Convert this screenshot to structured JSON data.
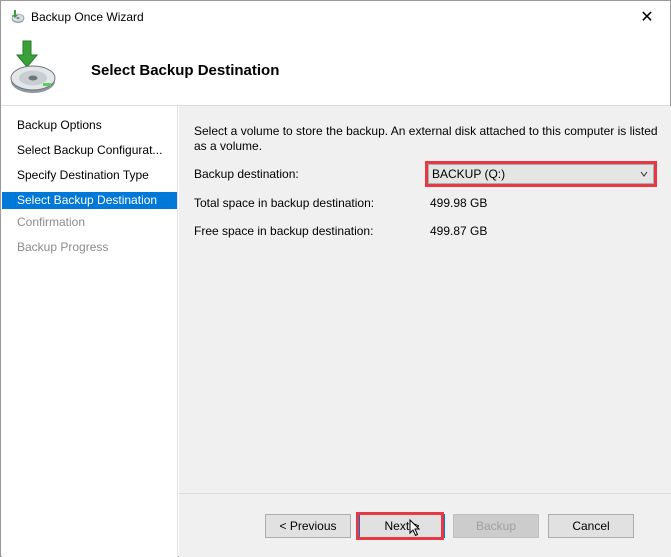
{
  "window": {
    "title": "Backup Once Wizard",
    "close_glyph": "✕"
  },
  "header": {
    "title": "Select Backup Destination",
    "icon": "backup-disk-icon"
  },
  "sidebar": {
    "items": [
      {
        "label": "Backup Options",
        "state": "normal"
      },
      {
        "label": "Select Backup Configurat...",
        "state": "normal"
      },
      {
        "label": "Specify Destination Type",
        "state": "normal"
      },
      {
        "label": "Select Backup Destination",
        "state": "active"
      },
      {
        "label": "Confirmation",
        "state": "disabled"
      },
      {
        "label": "Backup Progress",
        "state": "disabled"
      }
    ]
  },
  "content": {
    "intro": "Select a volume to store the backup. An external disk attached to this computer is listed as a volume.",
    "destination_label": "Backup destination:",
    "destination_value": "BACKUP (Q:)",
    "total_label": "Total space in backup destination:",
    "total_value": "499.98 GB",
    "free_label": "Free space in backup destination:",
    "free_value": "499.87 GB"
  },
  "buttons": {
    "previous": "< Previous",
    "next": "Next >",
    "backup": "Backup",
    "cancel": "Cancel"
  },
  "colors": {
    "accent": "#0078d7",
    "highlight": "#e63946",
    "content_bg": "#f0f0f0"
  }
}
